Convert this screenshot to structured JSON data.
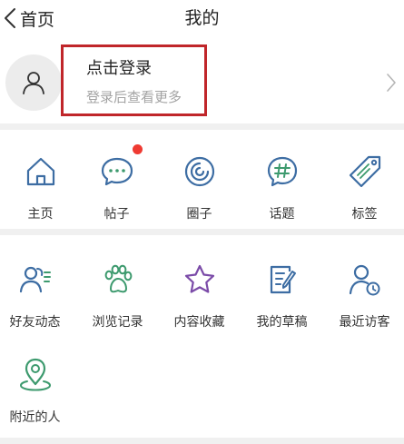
{
  "nav": {
    "back_label": "首页",
    "title": "我的"
  },
  "profile": {
    "login_title": "点击登录",
    "login_subtitle": "登录后查看更多"
  },
  "row1": [
    {
      "label": "主页",
      "icon": "home-icon"
    },
    {
      "label": "帖子",
      "icon": "chat-bubble-icon",
      "badge": true
    },
    {
      "label": "圈子",
      "icon": "circle-icon"
    },
    {
      "label": "话题",
      "icon": "hashtag-icon"
    },
    {
      "label": "标签",
      "icon": "tag-icon"
    }
  ],
  "row2": [
    {
      "label": "好友动态",
      "icon": "friends-icon"
    },
    {
      "label": "浏览记录",
      "icon": "paw-icon"
    },
    {
      "label": "内容收藏",
      "icon": "star-icon"
    },
    {
      "label": "我的草稿",
      "icon": "draft-icon"
    },
    {
      "label": "最近访客",
      "icon": "visitor-icon"
    }
  ],
  "row3": [
    {
      "label": "附近的人",
      "icon": "location-icon"
    }
  ],
  "colors": {
    "accent": "#3d6da3",
    "badge": "#ef3a32",
    "highlight": "#c0262a",
    "divider": "#f0f0f0"
  }
}
